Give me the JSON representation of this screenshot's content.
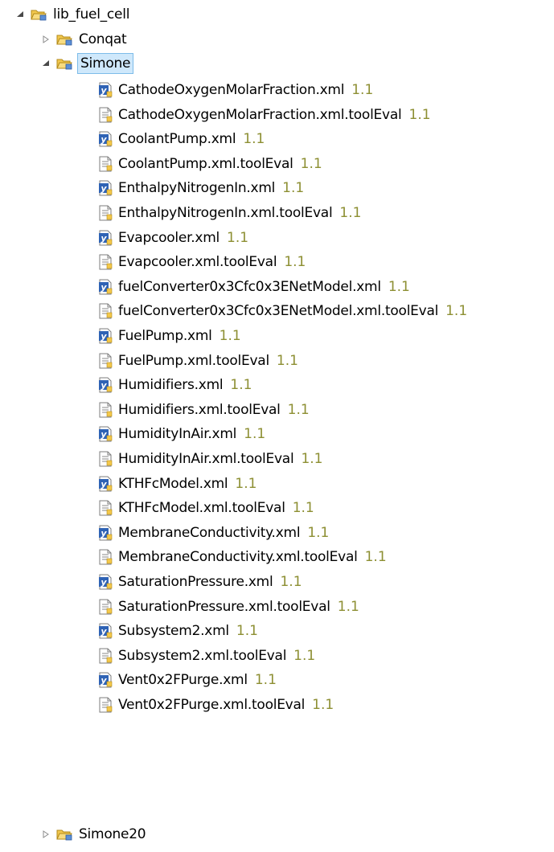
{
  "tree": {
    "root": {
      "label": "lib_fuel_cell",
      "expanded": true,
      "icon": "folder-open-icon"
    },
    "folders": [
      {
        "label": "Conqat",
        "expanded": false,
        "icon": "folder-icon"
      },
      {
        "label": "Simone",
        "expanded": true,
        "selected": true,
        "icon": "folder-open-icon"
      },
      {
        "label": "Simone20",
        "expanded": false,
        "icon": "folder-icon"
      }
    ],
    "files": [
      {
        "name": "CathodeOxygenMolarFraction.xml",
        "revision": "1.1",
        "icon": "xml-file-icon"
      },
      {
        "name": "CathodeOxygenMolarFraction.xml.toolEval",
        "revision": "1.1",
        "icon": "text-file-icon"
      },
      {
        "name": "CoolantPump.xml",
        "revision": "1.1",
        "icon": "xml-file-icon"
      },
      {
        "name": "CoolantPump.xml.toolEval",
        "revision": "1.1",
        "icon": "text-file-icon"
      },
      {
        "name": "EnthalpyNitrogenIn.xml",
        "revision": "1.1",
        "icon": "xml-file-icon"
      },
      {
        "name": "EnthalpyNitrogenIn.xml.toolEval",
        "revision": "1.1",
        "icon": "text-file-icon"
      },
      {
        "name": "Evapcooler.xml",
        "revision": "1.1",
        "icon": "xml-file-icon"
      },
      {
        "name": "Evapcooler.xml.toolEval",
        "revision": "1.1",
        "icon": "text-file-icon"
      },
      {
        "name": "fuelConverter0x3Cfc0x3ENetModel.xml",
        "revision": "1.1",
        "icon": "xml-file-icon"
      },
      {
        "name": "fuelConverter0x3Cfc0x3ENetModel.xml.toolEval",
        "revision": "1.1",
        "icon": "text-file-icon"
      },
      {
        "name": "FuelPump.xml",
        "revision": "1.1",
        "icon": "xml-file-icon"
      },
      {
        "name": "FuelPump.xml.toolEval",
        "revision": "1.1",
        "icon": "text-file-icon"
      },
      {
        "name": "Humidifiers.xml",
        "revision": "1.1",
        "icon": "xml-file-icon"
      },
      {
        "name": "Humidifiers.xml.toolEval",
        "revision": "1.1",
        "icon": "text-file-icon"
      },
      {
        "name": "HumidityInAir.xml",
        "revision": "1.1",
        "icon": "xml-file-icon"
      },
      {
        "name": "HumidityInAir.xml.toolEval",
        "revision": "1.1",
        "icon": "text-file-icon"
      },
      {
        "name": "KTHFcModel.xml",
        "revision": "1.1",
        "icon": "xml-file-icon"
      },
      {
        "name": "KTHFcModel.xml.toolEval",
        "revision": "1.1",
        "icon": "text-file-icon"
      },
      {
        "name": "MembraneConductivity.xml",
        "revision": "1.1",
        "icon": "xml-file-icon"
      },
      {
        "name": "MembraneConductivity.xml.toolEval",
        "revision": "1.1",
        "icon": "text-file-icon"
      },
      {
        "name": "SaturationPressure.xml",
        "revision": "1.1",
        "icon": "xml-file-icon"
      },
      {
        "name": "SaturationPressure.xml.toolEval",
        "revision": "1.1",
        "icon": "text-file-icon"
      },
      {
        "name": "Subsystem2.xml",
        "revision": "1.1",
        "icon": "xml-file-icon"
      },
      {
        "name": "Subsystem2.xml.toolEval",
        "revision": "1.1",
        "icon": "text-file-icon"
      },
      {
        "name": "Vent0x2FPurge.xml",
        "revision": "1.1",
        "icon": "xml-file-icon"
      },
      {
        "name": "Vent0x2FPurge.xml.toolEval",
        "revision": "1.1",
        "icon": "text-file-icon"
      }
    ]
  },
  "colors": {
    "revision_text": "#8d8f33",
    "selection_background": "#cfe8fb",
    "selection_border": "#7dbce9",
    "folder_yellow": "#f4c84a",
    "xml_badge_blue": "#2f63b5"
  }
}
